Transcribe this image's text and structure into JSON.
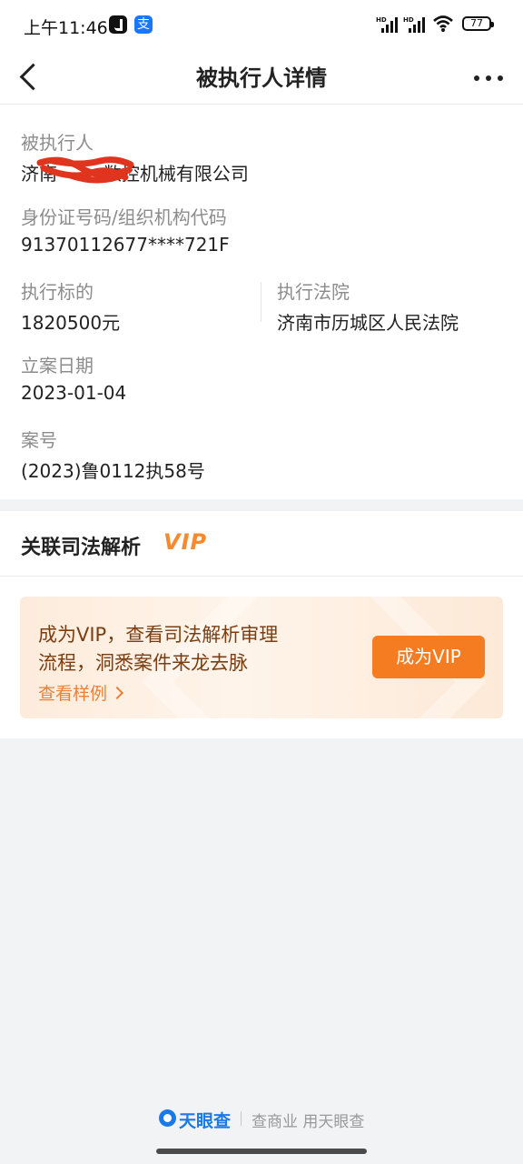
{
  "status_bar": {
    "time": "上午11:46",
    "alipay_glyph": "支",
    "signal_label": "HD",
    "battery": "77"
  },
  "nav": {
    "title": "被执行人详情",
    "back_icon": "chevron-left-icon",
    "more_icon": "more-dots-icon"
  },
  "detail": {
    "executee_label": "被执行人",
    "executee_value": "济南        数控机械有限公司",
    "id_label": "身份证号码/组织机构代码",
    "id_value": "91370112677****721F",
    "target_label": "执行标的",
    "target_value": "1820500元",
    "court_label": "执行法院",
    "court_value": "济南市历城区人民法院",
    "filing_date_label": "立案日期",
    "filing_date_value": "2023-01-04",
    "case_no_label": "案号",
    "case_no_value": "(2023)鲁0112执58号"
  },
  "related": {
    "title": "关联司法解析",
    "vip_badge": "VIP",
    "promo_line1": "成为VIP，查看司法解析审理",
    "promo_line2": "流程，洞悉案件来龙去脉",
    "promo_link": "查看样例",
    "promo_button": "成为VIP"
  },
  "footer": {
    "brand": "天眼查",
    "slogan": "查商业 用天眼查"
  },
  "colors": {
    "accent_orange": "#f67c22",
    "brand_blue": "#1a7ae8",
    "redaction_red": "#e0341e"
  }
}
